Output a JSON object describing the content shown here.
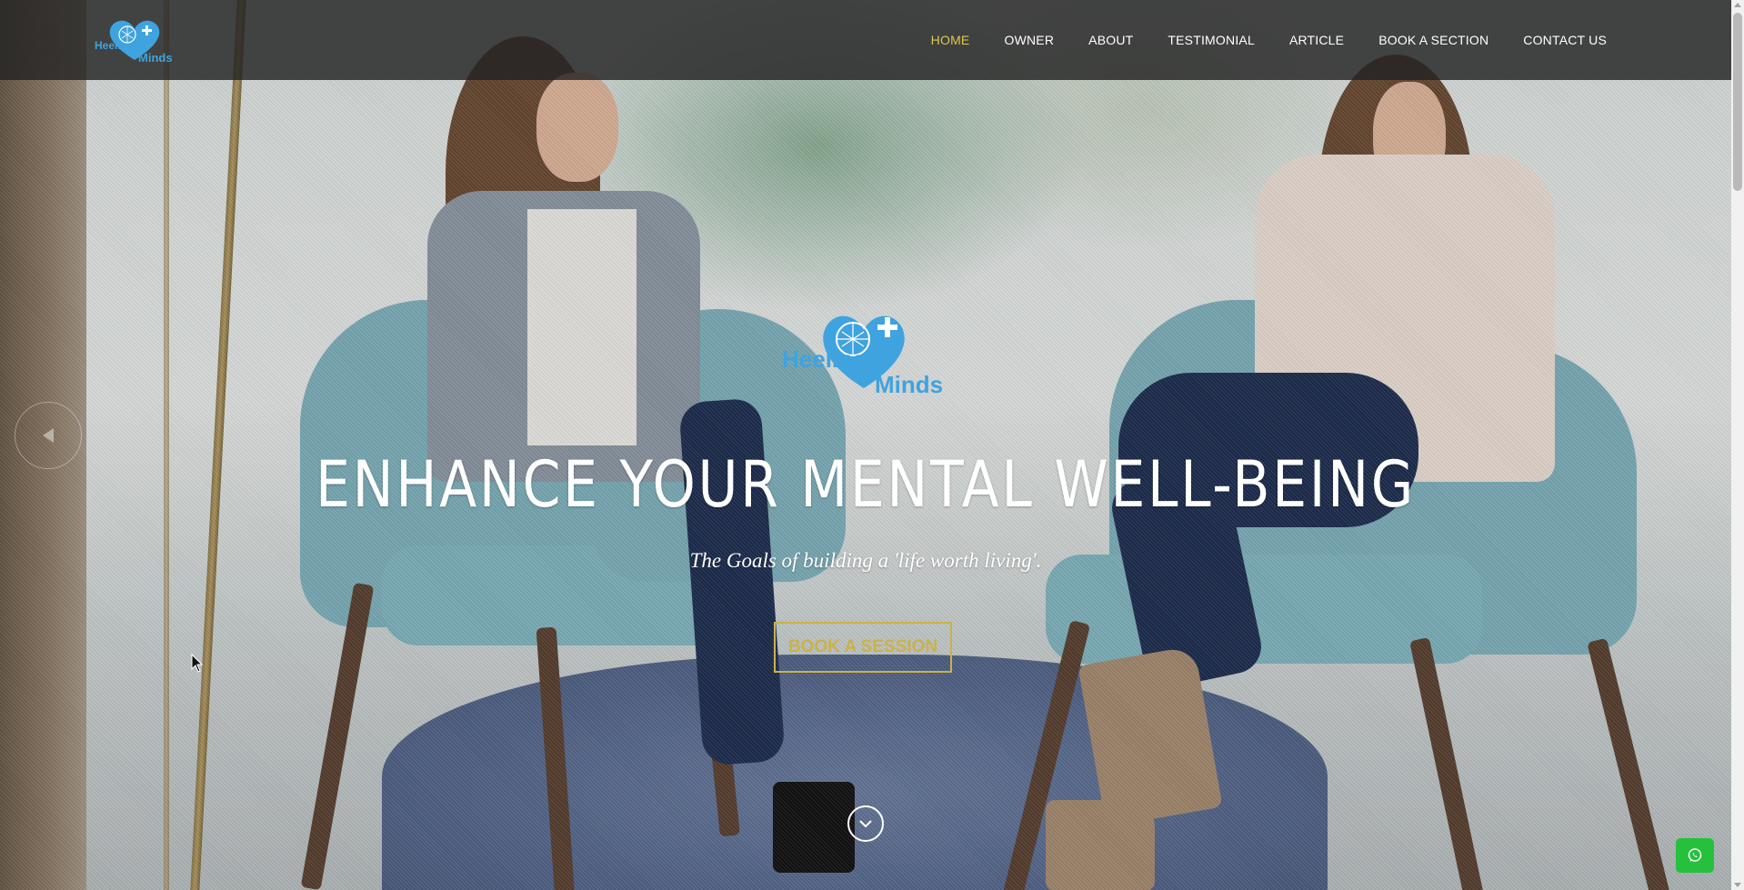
{
  "brand": {
    "logo_word_1": "Heeling",
    "logo_word_2": "Minds"
  },
  "nav": {
    "items": [
      {
        "label": "HOME",
        "active": true
      },
      {
        "label": "OWNER",
        "active": false
      },
      {
        "label": "ABOUT",
        "active": false
      },
      {
        "label": "TESTIMONIAL",
        "active": false
      },
      {
        "label": "ARTICLE",
        "active": false
      },
      {
        "label": "BOOK A SECTION",
        "active": false
      },
      {
        "label": "CONTACT US",
        "active": false
      }
    ]
  },
  "hero": {
    "headline": "ENHANCE YOUR MENTAL WELL-BEING",
    "tagline": "The Goals of building a 'life worth living'.",
    "cta_label": "BOOK A SESSION"
  },
  "icons": {
    "prev": "chevron-left-icon",
    "scroll_down": "chevron-down-icon",
    "whatsapp": "whatsapp-icon"
  },
  "colors": {
    "accent": "#e0c552",
    "cta_gold": "#c9b24a",
    "logo_blue": "#3fa3df",
    "whatsapp_green": "#25c03c",
    "navbar": "#232323"
  }
}
